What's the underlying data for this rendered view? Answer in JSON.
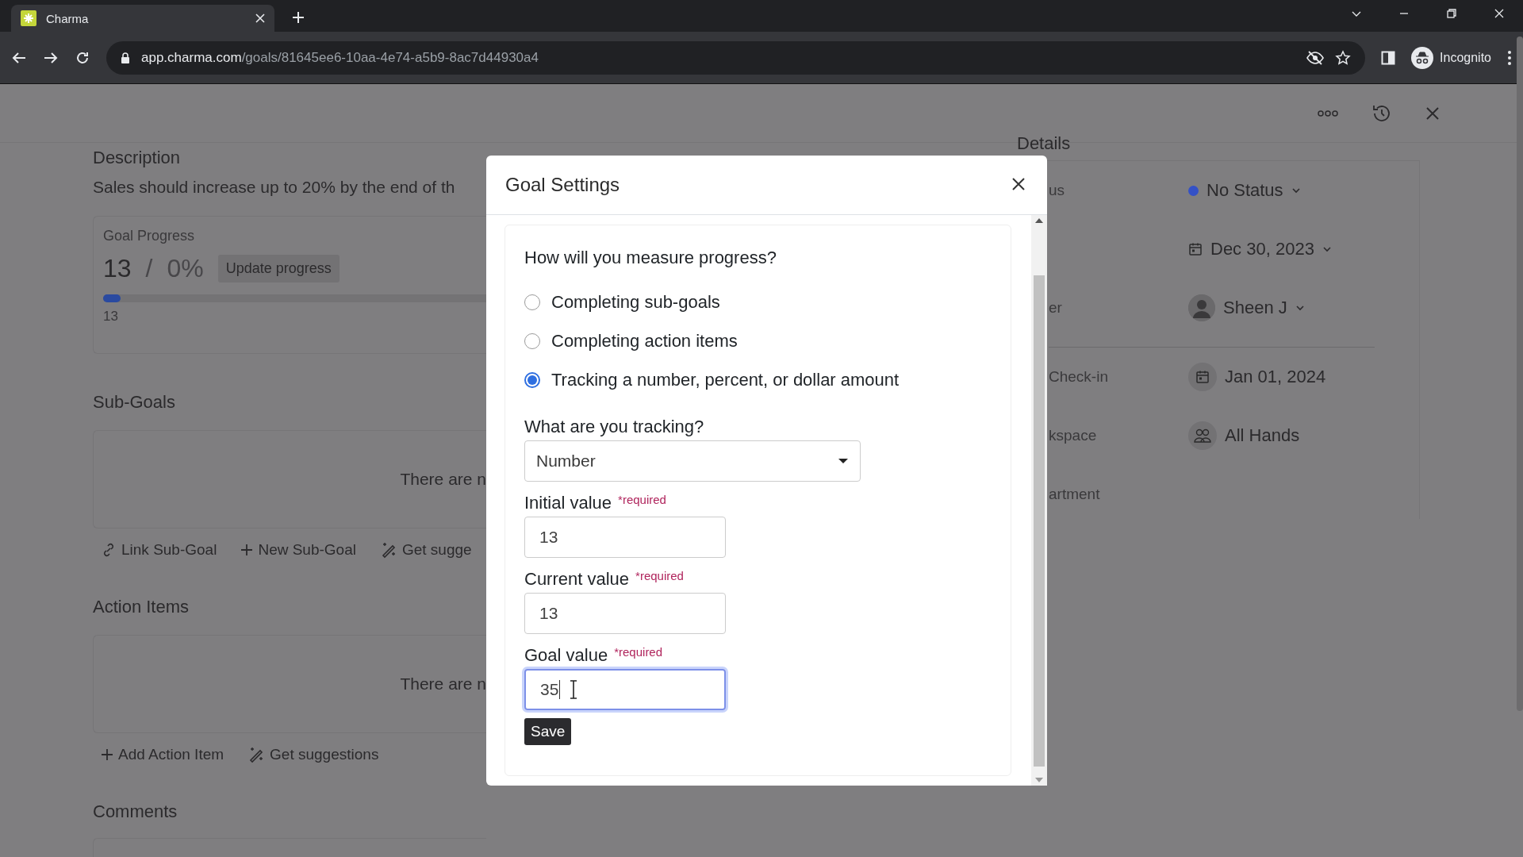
{
  "browser": {
    "tab_title": "Charma",
    "url_domain": "app.charma.com",
    "url_path": "/goals/81645ee6-10aa-4e74-a5b9-8ac7d44930a4",
    "profile": "Incognito"
  },
  "goal": {
    "description_heading": "Description",
    "description": "Sales should increase up to 20% by the end of th",
    "progress": {
      "label": "Goal Progress",
      "current": "13",
      "separator": "/",
      "percent": "0%",
      "button": "Update progress",
      "level": 0,
      "start": "13"
    },
    "sub_goals": {
      "heading": "Sub-Goals",
      "empty": "There are n",
      "actions": [
        {
          "kind": "link",
          "label": "Link Sub-Goal"
        },
        {
          "kind": "add",
          "label": "New Sub-Goal"
        },
        {
          "kind": "suggest",
          "label": "Get sugge"
        }
      ]
    },
    "action_items": {
      "heading": "Action Items",
      "empty": "There are n",
      "actions": [
        {
          "kind": "add",
          "label": "Add Action Item"
        },
        {
          "kind": "suggest",
          "label": "Get suggestions"
        }
      ]
    },
    "comments_heading": "Comments"
  },
  "details": {
    "heading": "Details",
    "rows": [
      {
        "kind": "status",
        "label": "us",
        "value": "No Status",
        "color": "#3451c6"
      },
      {
        "kind": "date",
        "value": "Dec 30, 2023"
      },
      {
        "kind": "person",
        "label": "er",
        "value": "Sheen J"
      },
      {
        "kind": "checkin",
        "label": "Check-in",
        "value": "Jan 01, 2024"
      },
      {
        "kind": "team",
        "label": "kspace",
        "value": "All Hands"
      },
      {
        "kind": "plain",
        "label": "artment"
      }
    ]
  },
  "modal": {
    "title": "Goal Settings",
    "question": "How will you measure progress?",
    "options": [
      {
        "label": "Completing sub-goals",
        "selected": false
      },
      {
        "label": "Completing action items",
        "selected": false
      },
      {
        "label": "Tracking a number, percent, or dollar amount",
        "selected": true
      }
    ],
    "tracking_label": "What are you tracking?",
    "tracking_value": "Number",
    "fields": [
      {
        "label": "Initial value",
        "required": "*required",
        "value": "13",
        "focused": false
      },
      {
        "label": "Current value",
        "required": "*required",
        "value": "13",
        "focused": false
      },
      {
        "label": "Goal value",
        "required": "*required",
        "value": "35",
        "focused": true
      }
    ],
    "save": "Save"
  }
}
